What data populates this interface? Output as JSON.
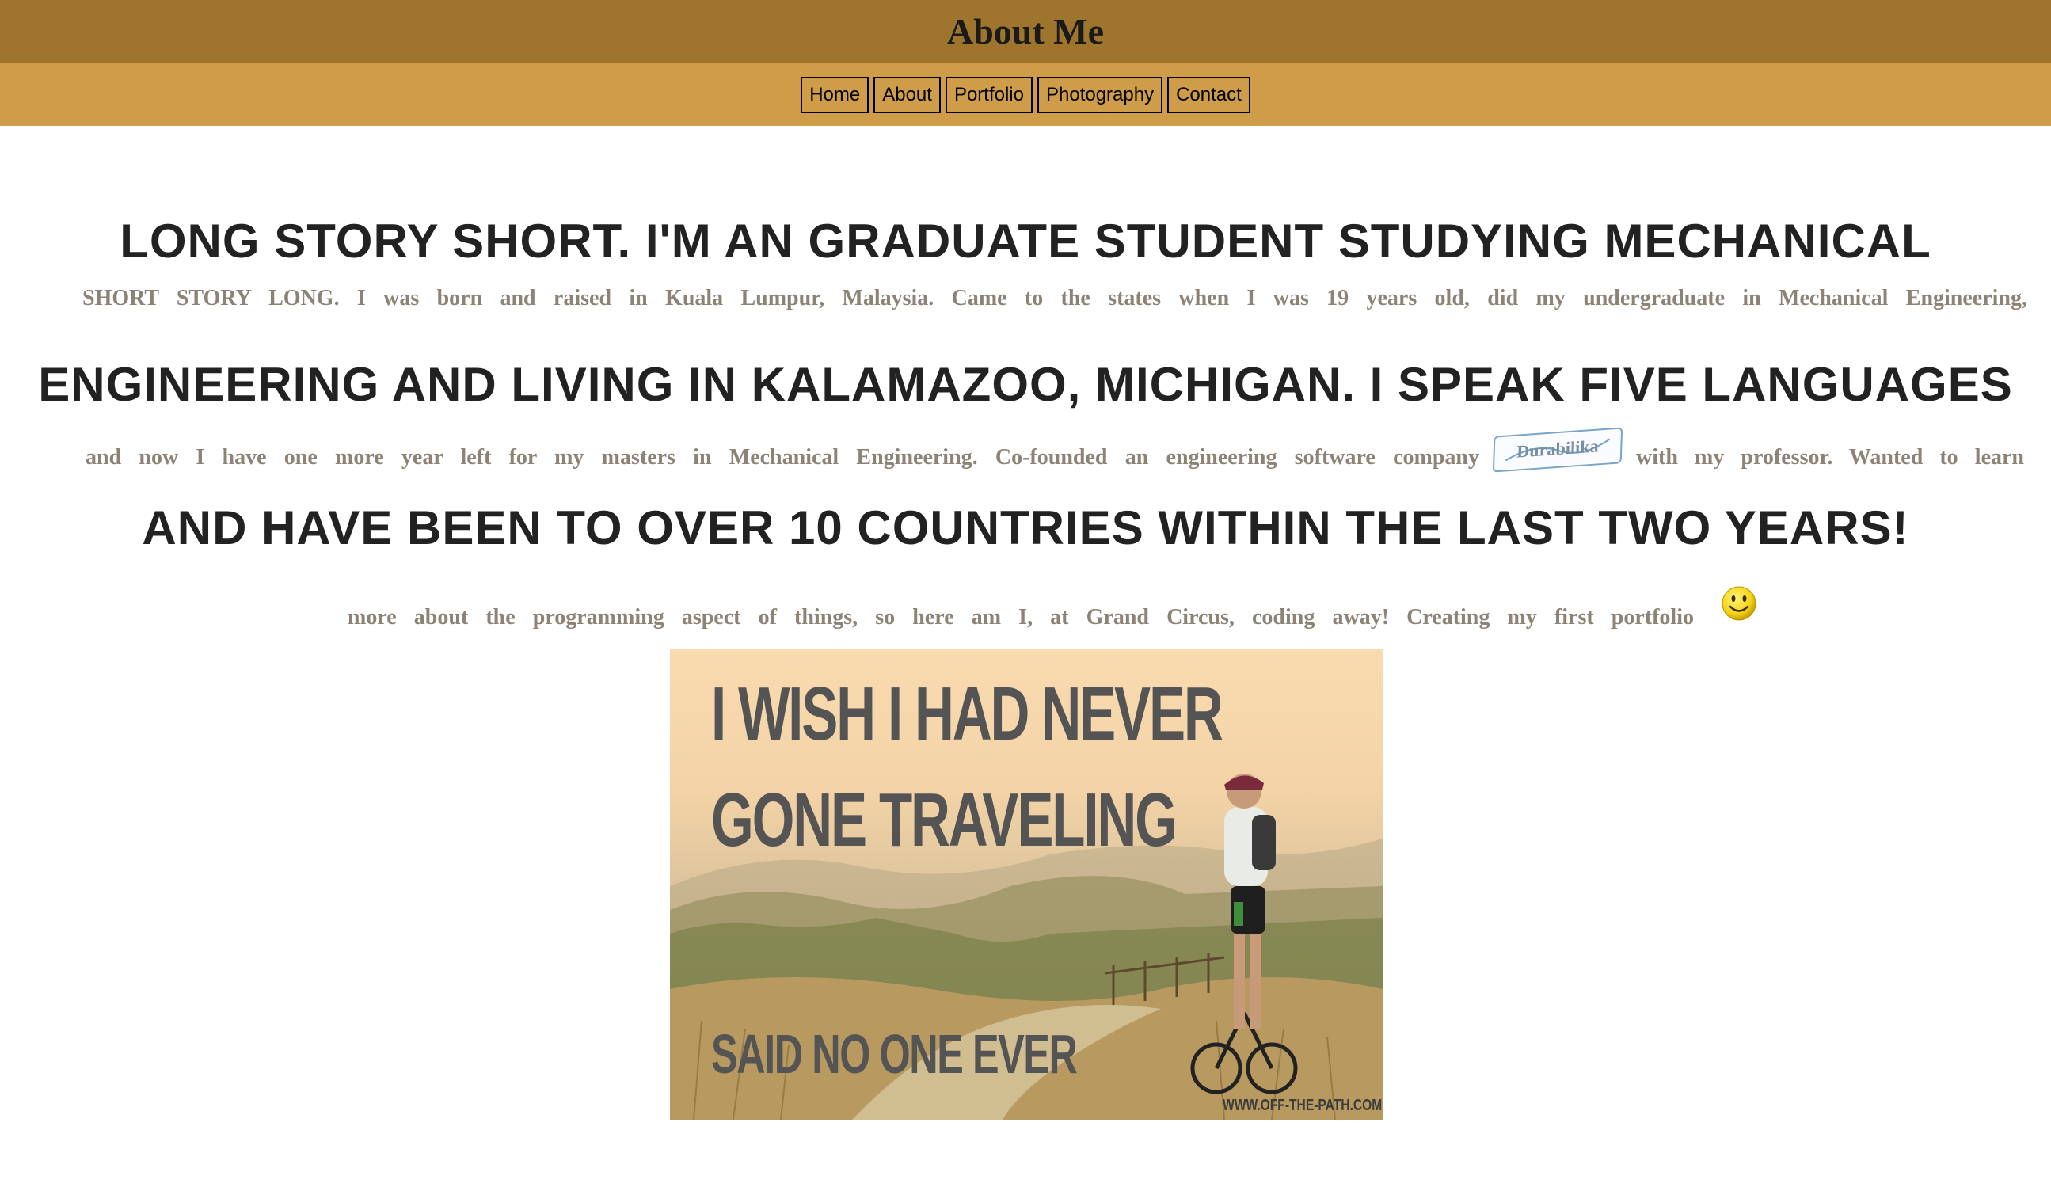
{
  "header": {
    "title": "About Me"
  },
  "nav": {
    "items": [
      {
        "label": "Home"
      },
      {
        "label": "About"
      },
      {
        "label": "Portfolio"
      },
      {
        "label": "Photography"
      },
      {
        "label": "Contact"
      }
    ]
  },
  "headline": {
    "line1": "LONG STORY SHORT. I'M AN GRADUATE STUDENT STUDYING MECHANICAL",
    "line2": "ENGINEERING AND LIVING IN KALAMAZOO, MICHIGAN. I SPEAK FIVE LANGUAGES",
    "line3": "AND HAVE BEEN TO OVER 10 COUNTRIES WITHIN THE LAST TWO YEARS!"
  },
  "story": {
    "line1": "SHORT STORY LONG. I was born and raised in Kuala Lumpur, Malaysia. Came to the states when I was 19 years old, did my undergraduate in Mechanical Engineering,",
    "line2_before": "and now I have one more year left for my masters in Mechanical Engineering. Co-founded an engineering software company",
    "company_logo": {
      "text": "Durabilika",
      "color": "#7aa4c8"
    },
    "line2_after": "with my professor. Wanted to learn",
    "line3": "more about the programming aspect of things, so here am I, at Grand Circus, coding away! Creating my first portfolio",
    "emoji": {
      "icon": "smiley-face-icon",
      "color": "#f5d416"
    }
  },
  "poster": {
    "line1": "I WISH I HAD NEVER",
    "line2": "GONE TRAVELING",
    "line3": "SAID NO ONE EVER",
    "credit": "WWW.OFF-THE-PATH.COM"
  },
  "colors": {
    "header": "#9f752e",
    "nav": "#cf9d4a",
    "headline_text": "#222222",
    "story_text": "#8c8275",
    "poster_text": "#545454"
  }
}
